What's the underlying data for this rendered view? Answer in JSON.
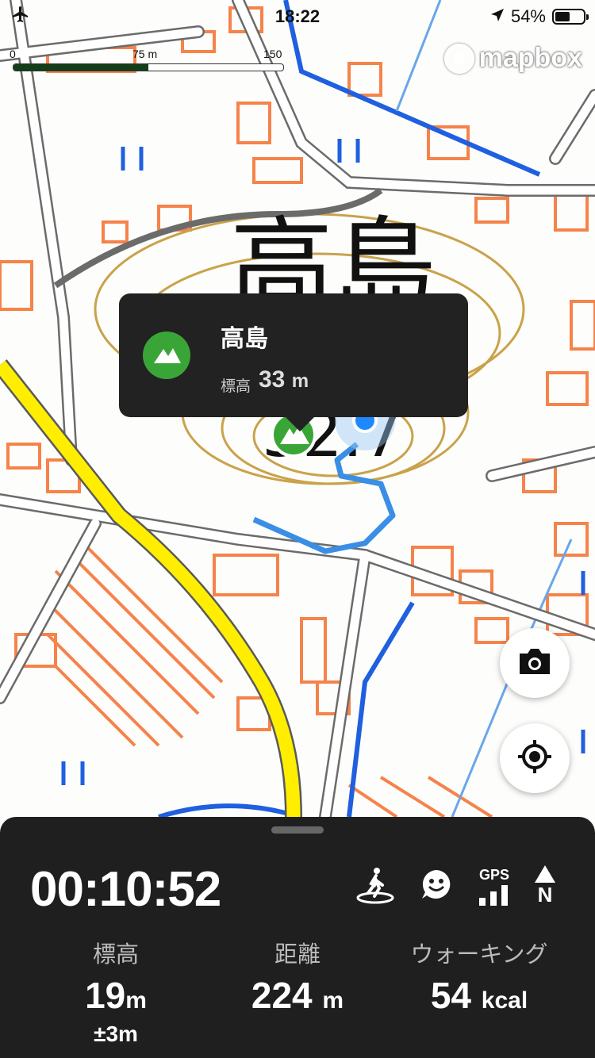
{
  "status_bar": {
    "time": "18:22",
    "battery": "54%",
    "battery_level": 0.54
  },
  "scale": {
    "labels": [
      "0",
      "75 m",
      "150 m"
    ]
  },
  "attribution": {
    "brand": "mapbox"
  },
  "map": {
    "place_label": "高島",
    "elevation_label": "32.7",
    "colors": {
      "road": "#6b6b6b",
      "building": "#f5834a",
      "contour": "#c9a24a",
      "water": "#1f5fe0",
      "highway": "#ffee00",
      "track": "#3a8ee6"
    }
  },
  "popup": {
    "title": "高島",
    "elevation_label": "標高",
    "elevation_value": "33",
    "elevation_unit": "m",
    "icon": "mountain-icon"
  },
  "buttons": {
    "camera": "camera-icon",
    "locate": "locate-icon"
  },
  "panel": {
    "timer": "00:10:52",
    "status_icons": [
      "walker-icon",
      "face-icon",
      "gps-signal-icon",
      "compass-north-icon"
    ],
    "gps_label": "GPS",
    "north_label": "N",
    "stats": [
      {
        "label": "標高",
        "value": "19",
        "unit": "m",
        "sub": "±3m"
      },
      {
        "label": "距離",
        "value": "224",
        "unit": "m"
      },
      {
        "label": "ウォーキング",
        "value": "54",
        "unit": "kcal"
      }
    ]
  }
}
